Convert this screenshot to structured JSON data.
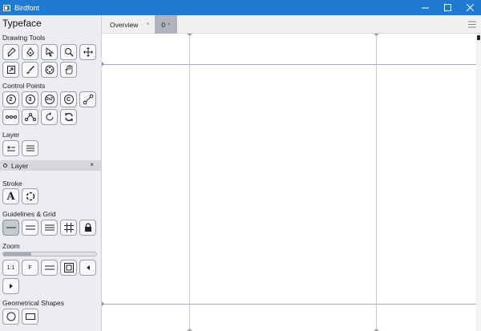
{
  "window": {
    "title": "Birdfont"
  },
  "window_controls": {
    "minimize": "minimize-icon",
    "maximize": "maximize-icon",
    "close": "close-icon"
  },
  "sidebar": {
    "title": "Typeface",
    "sections": {
      "drawing_tools": "Drawing Tools",
      "control_points": "Control Points",
      "layer": "Layer",
      "stroke": "Stroke",
      "guidelines": "Guidelines & Grid",
      "zoom": "Zoom",
      "shapes": "Geometrical Shapes"
    },
    "drawing_tools_icons": [
      "pen-icon",
      "pencil-icon",
      "pointer-icon",
      "zoom-icon",
      "move-icon",
      "resize-icon",
      "brush-icon",
      "rotate-icon",
      "hand-icon"
    ],
    "control_points": {
      "p2": "2",
      "p3": "3",
      "p2x2": "2x2",
      "c": "C"
    },
    "layer_item": {
      "name": "Layer",
      "close": "×"
    },
    "stroke_tools": {
      "text": "A"
    },
    "zoom": {
      "one_to_one": "1:1",
      "fit": "F",
      "level": 0.3
    },
    "shapes_icons": [
      "circle-icon",
      "rectangle-icon"
    ]
  },
  "tabs": [
    {
      "label": "Overview",
      "close": "×"
    },
    {
      "label": "0",
      "close": "×"
    }
  ],
  "colors": {
    "titlebar": "#1f7ad2",
    "sidebar": "#ecedf0",
    "active_tab": "#b0b3be",
    "guide": "#a8a8c8"
  }
}
